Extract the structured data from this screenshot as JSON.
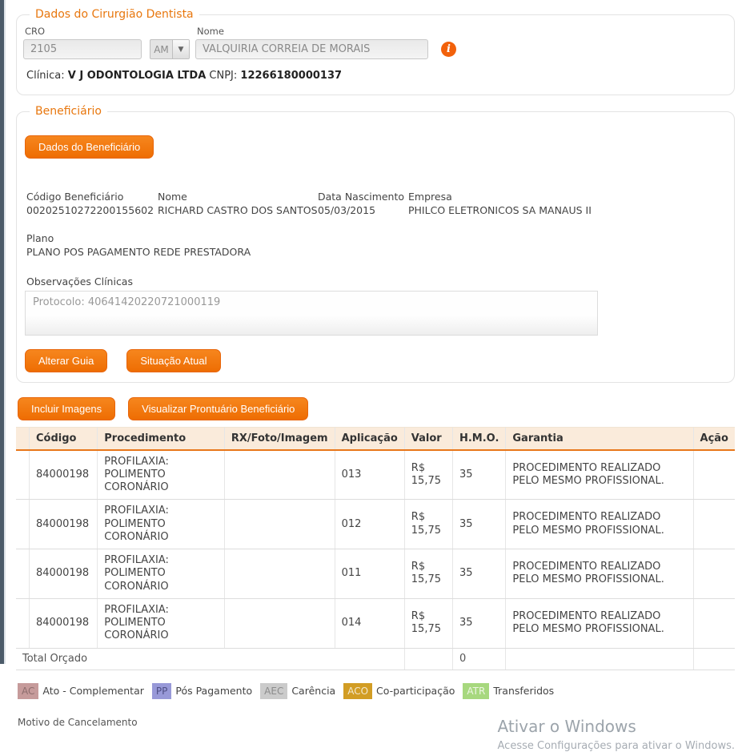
{
  "dentist": {
    "legend": "Dados do Cirurgião Dentista",
    "cro_label": "CRO",
    "cro_value": "2105",
    "uf_value": "AM",
    "nome_label": "Nome",
    "nome_value": "VALQUIRIA CORREIA DE MORAIS",
    "clinica_label": "Clínica:",
    "clinica_value": "V J ODONTOLOGIA LTDA",
    "cnpj_label": "CNPJ:",
    "cnpj_value": "12266180000137"
  },
  "beneficiary": {
    "legend": "Beneficiário",
    "dados_button": "Dados do Beneficiário",
    "codigo_label": "Código Beneficiário",
    "codigo_value": "00202510272200155602",
    "nome_label": "Nome",
    "nome_value": "RICHARD CASTRO DOS SANTOS",
    "nascimento_label": "Data Nascimento",
    "nascimento_value": "05/03/2015",
    "empresa_label": "Empresa",
    "empresa_value": "PHILCO ELETRONICOS SA MANAUS II",
    "plano_label": "Plano",
    "plano_value": "PLANO POS PAGAMENTO REDE PRESTADORA",
    "obs_label": "Observações Clínicas",
    "obs_value": "Protocolo: 40641420220721000119",
    "alterar_button": "Alterar Guia",
    "situacao_button": "Situação Atual"
  },
  "procedures": {
    "incluir_button": "Incluir Imagens",
    "visualizar_button": "Visualizar Prontuário Beneficiário",
    "table": {
      "headers": [
        "Código",
        "Procedimento",
        "RX/Foto/Imagem",
        "Aplicação",
        "Valor",
        "H.M.O.",
        "Garantia",
        "Ação"
      ],
      "row_keys": [
        "codigo",
        "procedimento",
        "rx",
        "aplicacao",
        "valor",
        "hmo",
        "garantia",
        "acao"
      ],
      "rows": [
        {
          "codigo": "84000198",
          "procedimento": "PROFILAXIA: POLIMENTO CORONÁRIO",
          "rx": "",
          "aplicacao": "013",
          "valor": "R$ 15,75",
          "hmo": "35",
          "garantia": "PROCEDIMENTO REALIZADO PELO MESMO PROFISSIONAL.",
          "acao": ""
        },
        {
          "codigo": "84000198",
          "procedimento": "PROFILAXIA: POLIMENTO CORONÁRIO",
          "rx": "",
          "aplicacao": "012",
          "valor": "R$ 15,75",
          "hmo": "35",
          "garantia": "PROCEDIMENTO REALIZADO PELO MESMO PROFISSIONAL.",
          "acao": ""
        },
        {
          "codigo": "84000198",
          "procedimento": "PROFILAXIA: POLIMENTO CORONÁRIO",
          "rx": "",
          "aplicacao": "011",
          "valor": "R$ 15,75",
          "hmo": "35",
          "garantia": "PROCEDIMENTO REALIZADO PELO MESMO PROFISSIONAL.",
          "acao": ""
        },
        {
          "codigo": "84000198",
          "procedimento": "PROFILAXIA: POLIMENTO CORONÁRIO",
          "rx": "",
          "aplicacao": "014",
          "valor": "R$ 15,75",
          "hmo": "35",
          "garantia": "PROCEDIMENTO REALIZADO PELO MESMO PROFISSIONAL.",
          "acao": ""
        }
      ],
      "total_label": "Total Orçado",
      "total_hmo": "0"
    },
    "legend": [
      {
        "code": "AC",
        "label": "Ato - Complementar",
        "color": "#C69B9B",
        "text_color": "#8d6d6d"
      },
      {
        "code": "PP",
        "label": "Pós Pagamento",
        "color": "#9899D8",
        "text_color": "#4f4f85"
      },
      {
        "code": "AEC",
        "label": "Carência",
        "color": "#CBCBCB",
        "text_color": "#8c8c8c"
      },
      {
        "code": "ACO",
        "label": "Co-participação",
        "color": "#D29D24",
        "text_color": "#f4e9cd"
      },
      {
        "code": "ATR",
        "label": "Transferidos",
        "color": "#A7D87E",
        "text_color": "#eef6e4"
      }
    ]
  },
  "footer": {
    "motivo_label": "Motivo de Cancelamento",
    "watermark_title": "Ativar o Windows",
    "watermark_subtitle": "Acesse Configurações para ativar o Windows."
  },
  "colors": {
    "accent_orange": "#EE6D03",
    "legend_text": "#E8770E",
    "table_header_bg": "#FAEBDB",
    "table_header_border": "#E8771A",
    "side_strip": "#4C5B69"
  }
}
